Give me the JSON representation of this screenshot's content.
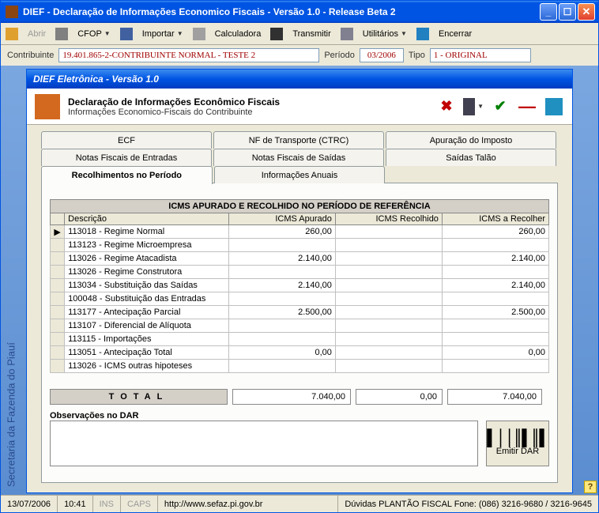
{
  "window": {
    "title": "DIEF - Declaração de Informações Economico Fiscais - Versão 1.0 - Release Beta 2"
  },
  "toolbar": {
    "abrir": "Abrir",
    "cfop": "CFOP",
    "importar": "Importar",
    "calculadora": "Calculadora",
    "transmitir": "Transmitir",
    "utilitarios": "Utilitários",
    "encerrar": "Encerrar"
  },
  "infobar": {
    "contribuinte_label": "Contribuinte",
    "contribuinte_value": "19.401.865-2-CONTRIBUINTE NORMAL - TESTE 2",
    "periodo_label": "Período",
    "periodo_value": "03/2006",
    "tipo_label": "Tipo",
    "tipo_value": "1 - ORIGINAL"
  },
  "side_text": "Secretaria da Fazenda do Piauí",
  "inner": {
    "title": "DIEF Eletrônica - Versão 1.0",
    "header_title": "Declaração de Informações Econômico Fiscais",
    "header_sub": "Informações Economico-Fiscais do Contribuinte"
  },
  "tabs": {
    "row1": [
      "ECF",
      "NF de Transporte (CTRC)",
      "Apuração do Imposto"
    ],
    "row2": [
      "Notas Fiscais de Entradas",
      "Notas Fiscais de Saídas",
      "Saídas Talão"
    ],
    "row3": [
      "Recolhimentos no Período",
      "Informações Anuais",
      ""
    ]
  },
  "table": {
    "title": "ICMS APURADO E RECOLHIDO NO PERÍODO DE REFERÊNCIA",
    "headers": [
      "Descrição",
      "ICMS Apurado",
      "ICMS Recolhido",
      "ICMS a Recolher"
    ],
    "rows": [
      {
        "desc": "113018 - Regime Normal",
        "apurado": "260,00",
        "recolhido": "",
        "arecolher": "260,00",
        "selected": true
      },
      {
        "desc": "113123 - Regime Microempresa",
        "apurado": "",
        "recolhido": "",
        "arecolher": ""
      },
      {
        "desc": "113026 - Regime Atacadista",
        "apurado": "2.140,00",
        "recolhido": "",
        "arecolher": "2.140,00"
      },
      {
        "desc": "113026 - Regime Construtora",
        "apurado": "",
        "recolhido": "",
        "arecolher": ""
      },
      {
        "desc": "113034 - Substituição das Saídas",
        "apurado": "2.140,00",
        "recolhido": "",
        "arecolher": "2.140,00"
      },
      {
        "desc": "100048 - Substituição das Entradas",
        "apurado": "",
        "recolhido": "",
        "arecolher": ""
      },
      {
        "desc": "113177 - Antecipação Parcial",
        "apurado": "2.500,00",
        "recolhido": "",
        "arecolher": "2.500,00"
      },
      {
        "desc": "113107 - Diferencial de Alíquota",
        "apurado": "",
        "recolhido": "",
        "arecolher": ""
      },
      {
        "desc": "113115 - Importações",
        "apurado": "",
        "recolhido": "",
        "arecolher": ""
      },
      {
        "desc": "113051 - Antecipação Total",
        "apurado": "0,00",
        "recolhido": "",
        "arecolher": "0,00"
      },
      {
        "desc": "113026 - ICMS outras hipoteses",
        "apurado": "",
        "recolhido": "",
        "arecolher": ""
      }
    ]
  },
  "totals": {
    "label": "TOTAL",
    "apurado": "7.040,00",
    "recolhido": "0,00",
    "arecolher": "7.040,00"
  },
  "obs_label": "Observações no DAR",
  "emitir_label": "Emitir DAR",
  "statusbar": {
    "date": "13/07/2006",
    "time": "10:41",
    "ins": "INS",
    "caps": "CAPS",
    "url": "http://www.sefaz.pi.gov.br",
    "help": "Dúvidas PLANTÃO FISCAL Fone: (086) 3216-9680 / 3216-9645"
  }
}
